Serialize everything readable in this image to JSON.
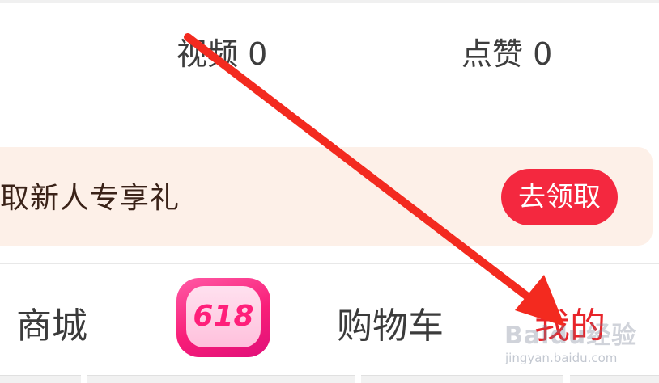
{
  "stats": {
    "videos": "视频 0",
    "likes": "点赞 0"
  },
  "banner": {
    "text": "取新人专享礼",
    "claim_button": "去领取",
    "background": "#fdf0e8",
    "button_color": "#f4283f"
  },
  "tabbar": {
    "tabs": [
      {
        "label": "商城",
        "active": false
      },
      {
        "label": "618",
        "active": false,
        "icon": "promo-618-icon"
      },
      {
        "label": "购物车",
        "active": false
      },
      {
        "label": "我的",
        "active": true
      }
    ],
    "active_color": "#e8242a",
    "inactive_color": "#3b3b3b"
  },
  "watermark": {
    "logo": "Baidu经验",
    "url": "jingyan.baidu.com"
  },
  "annotation": {
    "type": "red-arrow",
    "color": "#f32a1f"
  }
}
